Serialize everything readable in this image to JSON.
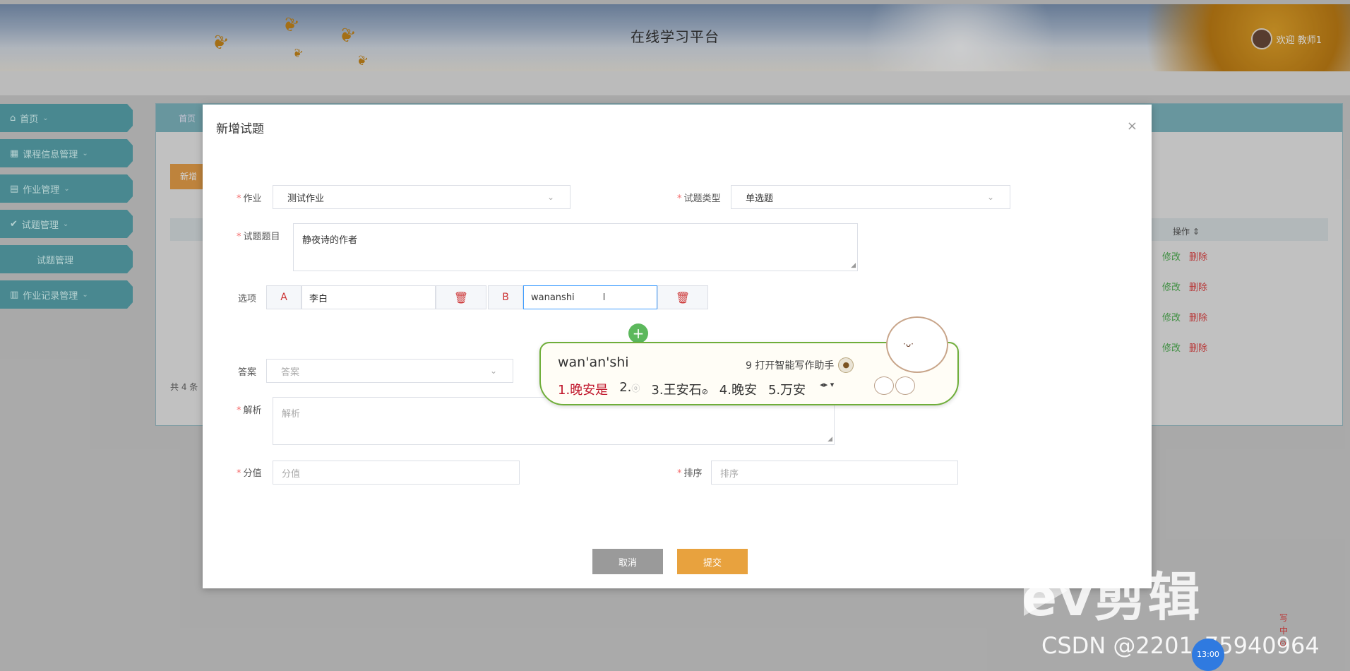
{
  "header": {
    "app_title": "在线学习平台",
    "welcome_text": "欢迎 教师1"
  },
  "sidebar": {
    "items": [
      {
        "label": "首页",
        "icon": "home-icon"
      },
      {
        "label": "课程信息管理",
        "icon": "grid-icon"
      },
      {
        "label": "作业管理",
        "icon": "book-icon"
      },
      {
        "label": "试题管理",
        "icon": "check-circle-icon"
      },
      {
        "label": "试题管理",
        "sub": true
      },
      {
        "label": "作业记录管理",
        "icon": "table-icon"
      }
    ]
  },
  "background": {
    "tab_label": "首页",
    "add_button": "新增",
    "ops_header": "操作 ⇕",
    "edit_label": "修改",
    "delete_label": "删除",
    "total_text": "共 4 条"
  },
  "modal": {
    "title": "新增试题",
    "close_symbol": "×",
    "homework_label": "作业",
    "homework_value": "测试作业",
    "question_type_label": "试题类型",
    "question_type_value": "单选题",
    "question_title_label": "试题题目",
    "question_title_value": "静夜诗的作者",
    "options_label": "选项",
    "options": [
      {
        "letter": "A",
        "value": "李白"
      },
      {
        "letter": "B",
        "value": "wananshi"
      }
    ],
    "add_option_symbol": "+",
    "answer_label": "答案",
    "answer_placeholder": "答案",
    "analysis_label": "解析",
    "analysis_placeholder": "解析",
    "score_label": "分值",
    "score_placeholder": "分值",
    "sort_label": "排序",
    "sort_placeholder": "排序",
    "cancel_button": "取消",
    "submit_button": "提交"
  },
  "ime": {
    "input": "wan'an'shi",
    "assist": "9 打开智能写作助手",
    "candidates": [
      "1.晚安是",
      "2.",
      "3.王安石",
      "4.晚安",
      "5.万安"
    ]
  },
  "watermark": {
    "logo_text": "ev剪辑",
    "csdn": "CSDN @2201_75940964",
    "clock": "13:00",
    "stack": [
      "写",
      "中",
      "⊙"
    ]
  }
}
